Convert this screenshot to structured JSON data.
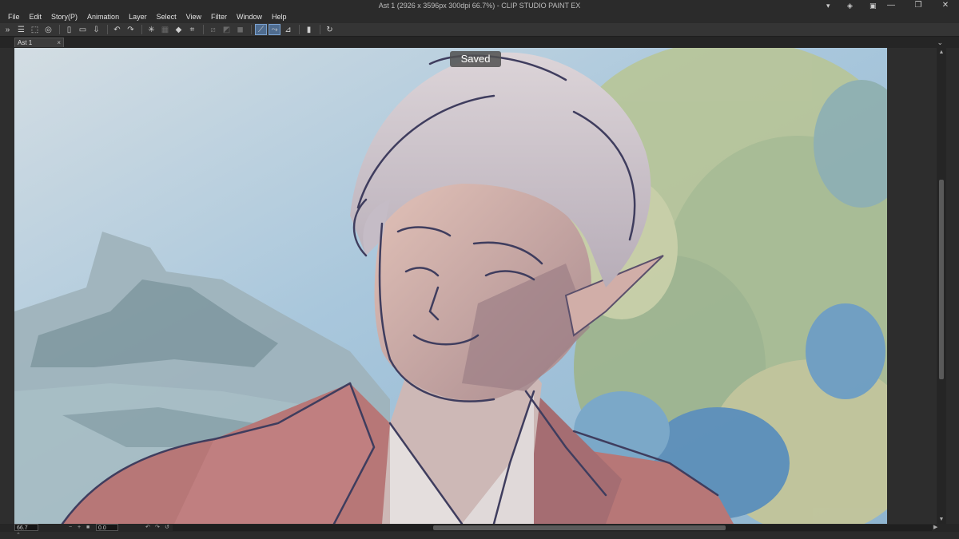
{
  "window": {
    "title": "Ast 1 (2926 x 3596px 300dpi 66.7%) - CLIP STUDIO PAINT EX",
    "minimize": "—",
    "maximize": "❐",
    "close": "✕",
    "extra_icons": [
      "chevron-down-icon",
      "settings-icon",
      "user-icon"
    ]
  },
  "menu": [
    "File",
    "Edit",
    "Story(P)",
    "Animation",
    "Layer",
    "Select",
    "View",
    "Filter",
    "Window",
    "Help"
  ],
  "document": {
    "tab_label": "Ast 1",
    "tab_close": "×"
  },
  "notification": "Saved",
  "status": {
    "zoom": "66.7",
    "rotation": "0.0",
    "zoom_minus": "−",
    "zoom_plus": "+"
  },
  "colors": {
    "app_bg": "#2b2b2b",
    "toolbar_bg": "#353535",
    "active_tool": "#4f6c8f"
  }
}
